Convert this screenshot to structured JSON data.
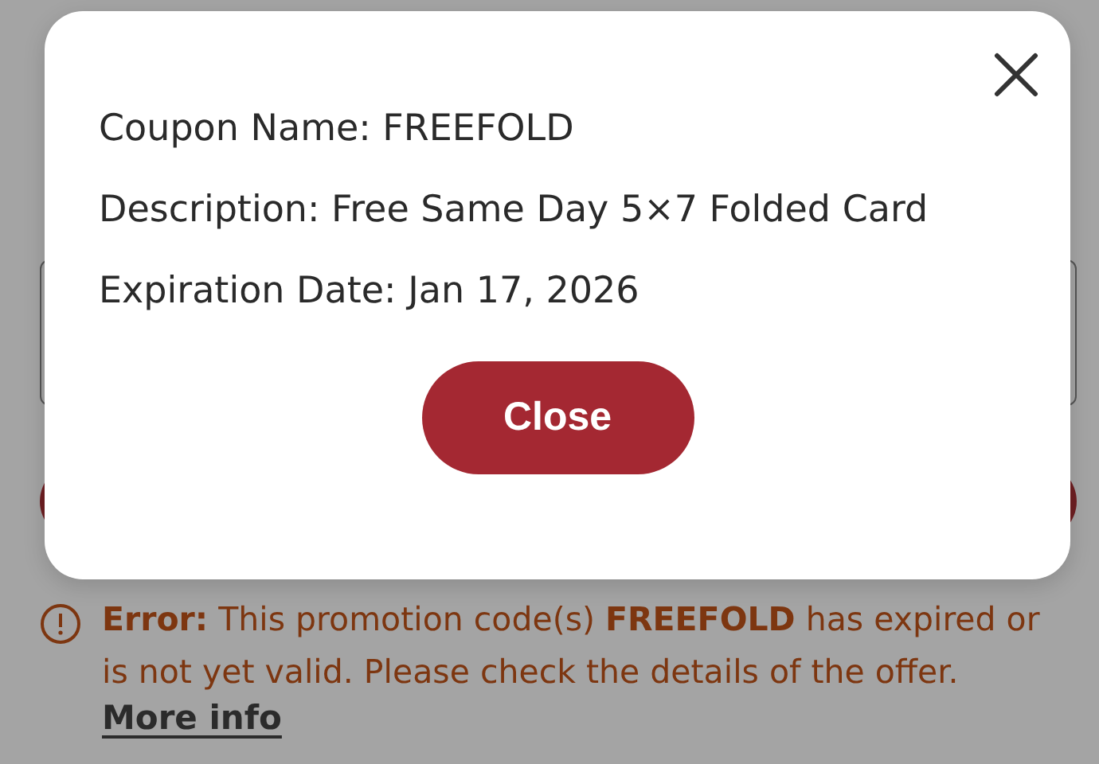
{
  "dialog": {
    "lines": [
      "Coupon Name: FREEFOLD",
      "Description: Free Same Day 5×7 Folded Card",
      "Expiration Date: Jan 17, 2026"
    ],
    "close_button": "Close"
  },
  "error": {
    "message": "**Error:** This promotion code(s) **FREEFOLD** has expired or is not yet valid. Please check the details of the offer.",
    "link": "More info"
  }
}
